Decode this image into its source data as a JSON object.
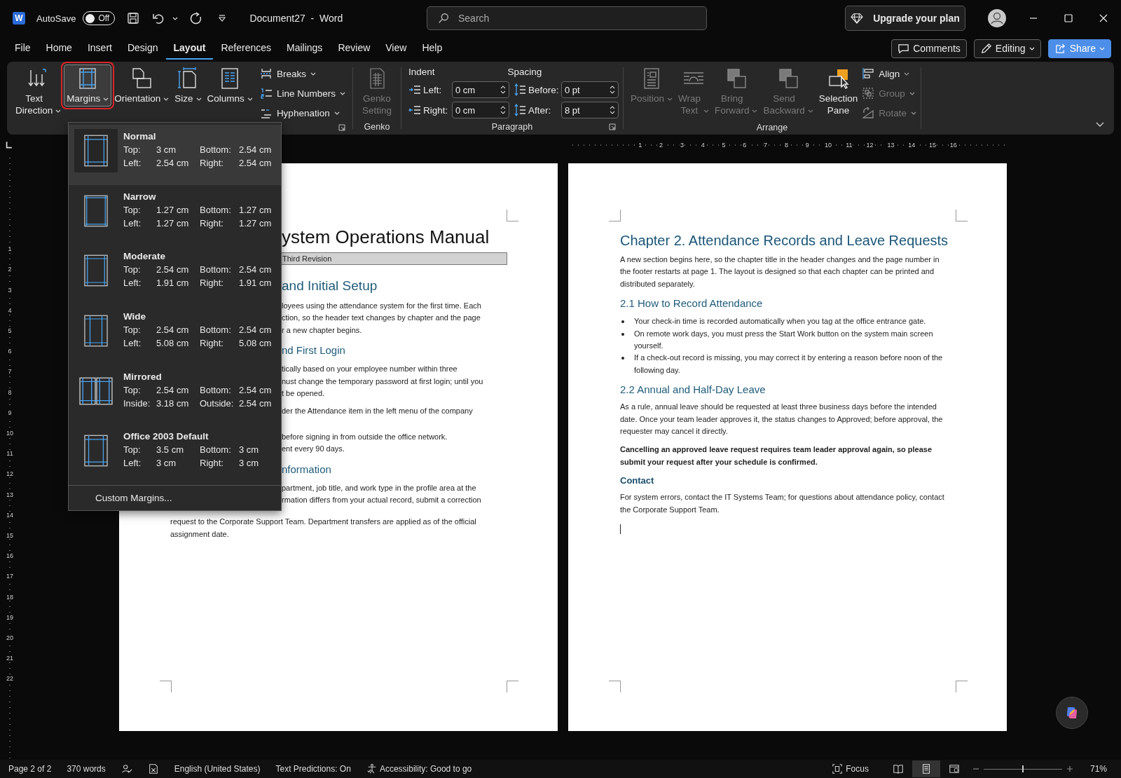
{
  "title_bar": {
    "app_logo": "W",
    "autosave_label": "AutoSave",
    "autosave": {
      "label": "Off",
      "on": false
    },
    "document_title": "Document27  -  Word",
    "search": {
      "placeholder": "Search"
    },
    "upgrade_button": "Upgrade your plan"
  },
  "menu_tabs": [
    {
      "label": "File",
      "selected": false
    },
    {
      "label": "Home",
      "selected": false
    },
    {
      "label": "Insert",
      "selected": false
    },
    {
      "label": "Design",
      "selected": false
    },
    {
      "label": "Layout",
      "selected": true
    },
    {
      "label": "References",
      "selected": false
    },
    {
      "label": "Mailings",
      "selected": false
    },
    {
      "label": "Review",
      "selected": false
    },
    {
      "label": "View",
      "selected": false
    },
    {
      "label": "Help",
      "selected": false
    }
  ],
  "header_buttons": [
    {
      "kind": "comments",
      "label": "Comments"
    },
    {
      "kind": "editing",
      "label": "Editing"
    },
    {
      "kind": "share",
      "label": "Share"
    }
  ],
  "ribbon": {
    "page_setup": {
      "large": [
        {
          "kind": "text-direction",
          "label": "Text Direction",
          "open": false
        },
        {
          "kind": "margins",
          "label": "Margins",
          "open": true
        },
        {
          "kind": "orientation",
          "label": "Orientation",
          "open": false
        },
        {
          "kind": "size",
          "label": "Size",
          "open": false
        },
        {
          "kind": "columns",
          "label": "Columns",
          "open": false
        }
      ],
      "small": [
        {
          "kind": "breaks",
          "label": "Breaks"
        },
        {
          "kind": "line-numbers",
          "label": "Line Numbers"
        },
        {
          "kind": "hyphenation",
          "label": "Hyphenation"
        }
      ]
    },
    "genko": {
      "button": "Genko Setting",
      "disabled": true,
      "group": "Genko"
    },
    "paragraph": {
      "indent_title": "Indent",
      "spacing_title": "Spacing",
      "fields": [
        {
          "kind": "indent-left",
          "label": "Left:",
          "value": "0 cm"
        },
        {
          "kind": "spacing-before",
          "label": "Before:",
          "value": "0 pt"
        },
        {
          "kind": "indent-right",
          "label": "Right:",
          "value": "0 cm"
        },
        {
          "kind": "spacing-after",
          "label": "After:",
          "value": "8 pt"
        }
      ],
      "group": "Paragraph"
    },
    "arrange": {
      "large": [
        {
          "kind": "position",
          "label": "Position",
          "disabled": true
        },
        {
          "kind": "wrap-text",
          "label": "Wrap Text",
          "disabled": true
        },
        {
          "kind": "bring-forward",
          "label": "Bring Forward",
          "disabled": true
        },
        {
          "kind": "send-backward",
          "label": "Send Backward",
          "disabled": true
        },
        {
          "kind": "selection-pane",
          "label": "Selection Pane",
          "disabled": false
        }
      ],
      "small": [
        {
          "kind": "align",
          "label": "Align",
          "disabled": false
        },
        {
          "kind": "group",
          "label": "Group",
          "disabled": true
        },
        {
          "kind": "rotate",
          "label": "Rotate",
          "disabled": true
        }
      ],
      "group": "Arrange"
    }
  },
  "rulers": {
    "horizontal": [
      "1",
      "2",
      "3",
      "4",
      "5",
      "6",
      "7",
      "8",
      "9",
      "10",
      "11",
      "12",
      "13",
      "14",
      "15",
      "16"
    ],
    "vertical": [
      "1",
      "2",
      "3",
      "4",
      "5",
      "6",
      "7",
      "8",
      "9",
      "10",
      "11",
      "12",
      "13",
      "14",
      "15",
      "16",
      "17",
      "18",
      "19",
      "20",
      "21",
      "22"
    ]
  },
  "margins_menu": {
    "items": [
      {
        "kind": "normal",
        "name": "Normal",
        "selected": true,
        "values": [
          {
            "label": "Top:",
            "value": "3 cm"
          },
          {
            "label": "Bottom:",
            "value": "2.54 cm"
          },
          {
            "label": "Left:",
            "value": "2.54 cm"
          },
          {
            "label": "Right:",
            "value": "2.54 cm"
          }
        ]
      },
      {
        "kind": "narrow",
        "name": "Narrow",
        "selected": false,
        "values": [
          {
            "label": "Top:",
            "value": "1.27 cm"
          },
          {
            "label": "Bottom:",
            "value": "1.27 cm"
          },
          {
            "label": "Left:",
            "value": "1.27 cm"
          },
          {
            "label": "Right:",
            "value": "1.27 cm"
          }
        ]
      },
      {
        "kind": "moderate",
        "name": "Moderate",
        "selected": false,
        "values": [
          {
            "label": "Top:",
            "value": "2.54 cm"
          },
          {
            "label": "Bottom:",
            "value": "2.54 cm"
          },
          {
            "label": "Left:",
            "value": "1.91 cm"
          },
          {
            "label": "Right:",
            "value": "1.91 cm"
          }
        ]
      },
      {
        "kind": "wide",
        "name": "Wide",
        "selected": false,
        "values": [
          {
            "label": "Top:",
            "value": "2.54 cm"
          },
          {
            "label": "Bottom:",
            "value": "2.54 cm"
          },
          {
            "label": "Left:",
            "value": "5.08 cm"
          },
          {
            "label": "Right:",
            "value": "5.08 cm"
          }
        ]
      },
      {
        "kind": "mirrored",
        "name": "Mirrored",
        "selected": false,
        "values": [
          {
            "label": "Top:",
            "value": "2.54 cm"
          },
          {
            "label": "Bottom:",
            "value": "2.54 cm"
          },
          {
            "label": "Inside:",
            "value": "3.18 cm"
          },
          {
            "label": "Outside:",
            "value": "2.54 cm"
          }
        ]
      },
      {
        "kind": "office2003",
        "name": "Office 2003 Default",
        "selected": false,
        "values": [
          {
            "label": "Top:",
            "value": "3.5 cm"
          },
          {
            "label": "Bottom:",
            "value": "3 cm"
          },
          {
            "label": "Left:",
            "value": "3 cm"
          },
          {
            "label": "Right:",
            "value": "3 cm"
          }
        ]
      }
    ],
    "custom": "Custom Margins..."
  },
  "page1": {
    "blocks": [
      {
        "kind": "title",
        "lines": [
          "ystem Operations Manual"
        ]
      },
      {
        "kind": "bar",
        "lines": [
          "Third Revision"
        ]
      },
      {
        "kind": "h1",
        "lines": [
          "and Initial Setup"
        ]
      },
      {
        "kind": "p",
        "lines": [
          "loyees using the attendance system for the first time. Each",
          "ction, so the header text changes by chapter and the page",
          "r a new chapter begins."
        ]
      },
      {
        "kind": "h2",
        "lines": [
          "nd First Login"
        ]
      },
      {
        "kind": "p",
        "lines": [
          "tically based on your employee number within three",
          "nust change the temporary password at first login; until you",
          "t be opened."
        ]
      },
      {
        "kind": "p",
        "lines": [
          "der the Attendance item in the left menu of the company"
        ]
      },
      {
        "kind": "p-gap",
        "lines": [
          "before signing in from outside the office network.",
          "ent every 90 days."
        ]
      },
      {
        "kind": "h2",
        "lines": [
          "nformation"
        ]
      },
      {
        "kind": "p",
        "lines": [
          "partment, job title, and work type in the profile area at the",
          "rmation differs from your actual record, submit a correction"
        ]
      },
      {
        "kind": "p-full",
        "lines": [
          "request to the Corporate Support Team. Department transfers are applied as of the official",
          "assignment date."
        ]
      }
    ]
  },
  "page2": {
    "blocks": [
      {
        "kind": "h1",
        "text": "Chapter 2. Attendance Records and Leave Requests"
      },
      {
        "kind": "p",
        "text": "A new section begins here, so the chapter title in the header changes and the page number in the footer restarts at page 1. The layout is designed so that each chapter can be printed and distributed separately."
      },
      {
        "kind": "h2",
        "text": "2.1 How to Record Attendance"
      },
      {
        "kind": "bullets",
        "items": [
          "Your check-in time is recorded automatically when you tag at the office entrance gate.",
          "On remote work days, you must press the Start Work button on the system main screen yourself.",
          "If a check-out record is missing, you may correct it by entering a reason before noon of the following day."
        ]
      },
      {
        "kind": "h2",
        "text": "2.2 Annual and Half-Day Leave"
      },
      {
        "kind": "p",
        "text": "As a rule, annual leave should be requested at least three business days before the intended date. Once your team leader approves it, the status changes to Approved; before approval, the requester may cancel it directly."
      },
      {
        "kind": "strong",
        "text": "Cancelling an approved leave request requires team leader approval again, so please submit your request after your schedule is confirmed."
      },
      {
        "kind": "h3",
        "text": "Contact"
      },
      {
        "kind": "p",
        "text": "For system errors, contact the IT Systems Team; for questions about attendance policy, contact the Corporate Support Team."
      }
    ]
  },
  "status_bar": {
    "page": "Page 2 of 2",
    "words": "370 words",
    "language": "English (United States)",
    "predictions": "Text Predictions: On",
    "accessibility": "Accessibility: Good to go",
    "focus": "Focus",
    "views": [
      {
        "kind": "read",
        "selected": false
      },
      {
        "kind": "print",
        "selected": true
      },
      {
        "kind": "web",
        "selected": false
      }
    ],
    "zoom": {
      "level": 0.5,
      "label": "71%"
    }
  }
}
